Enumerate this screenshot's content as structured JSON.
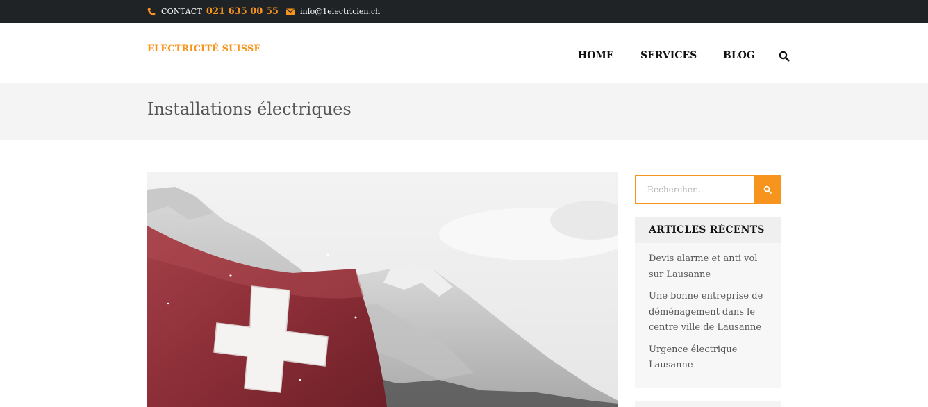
{
  "topbar": {
    "contact_label": "CONTACT",
    "phone": "021 635 00 55",
    "email": "info@1electricien.ch",
    "phone_icon": "phone-icon",
    "mail_icon": "envelope-icon"
  },
  "header": {
    "logo_text": "ELECTRICITÉ SUISSE",
    "nav": [
      "HOME",
      "SERVICES",
      "BLOG"
    ],
    "search_icon": "search-icon"
  },
  "page": {
    "title": "Installations électriques"
  },
  "hero": {
    "image": "swiss-flag-mountains"
  },
  "sidebar": {
    "search_placeholder": "Rechercher...",
    "recent_title": "ARTICLES RÉCENTS",
    "recent_posts": [
      "Devis alarme et anti vol sur Lausanne",
      "Une bonne entreprise de déménagement dans le centre ville de Lausanne",
      "Urgence électrique Lausanne"
    ]
  },
  "colors": {
    "accent": "#f7941d",
    "topbar_bg": "#1f2326",
    "title_band_bg": "#f4f4f4"
  }
}
